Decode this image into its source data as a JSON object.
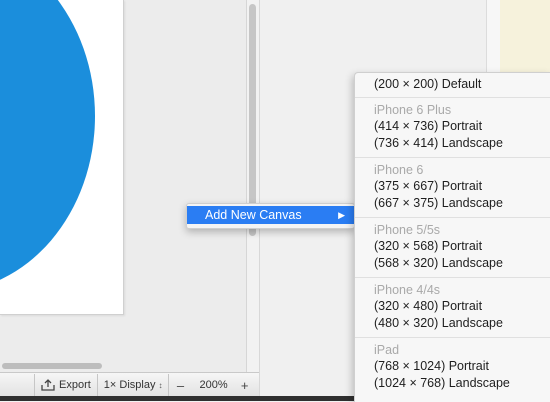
{
  "canvas": {
    "artboard_shape_color": "#1b8edc"
  },
  "toolbar": {
    "export_label": "Export",
    "display_label": "1× Display",
    "display_chevron": "↕",
    "zoom_out": "–",
    "zoom_level": "200%",
    "zoom_in": "+"
  },
  "context_menu": {
    "item_label": "Add New Canvas",
    "item_arrow": "▶",
    "highlight_color": "#2a7df3"
  },
  "submenu": {
    "default_item": "(200 × 200) Default",
    "groups": [
      {
        "header": "iPhone 6 Plus",
        "portrait": "(414 × 736) Portrait",
        "landscape": "(736 × 414) Landscape"
      },
      {
        "header": "iPhone 6",
        "portrait": "(375 × 667) Portrait",
        "landscape": "(667 × 375) Landscape"
      },
      {
        "header": "iPhone 5/5s",
        "portrait": "(320 × 568) Portrait",
        "landscape": "(568 × 320) Landscape"
      },
      {
        "header": "iPhone 4/4s",
        "portrait": "(320 × 480) Portrait",
        "landscape": "(480 × 320) Landscape"
      },
      {
        "header": "iPad",
        "portrait": "(768 × 1024) Portrait",
        "landscape": "(1024 × 768) Landscape"
      }
    ]
  }
}
